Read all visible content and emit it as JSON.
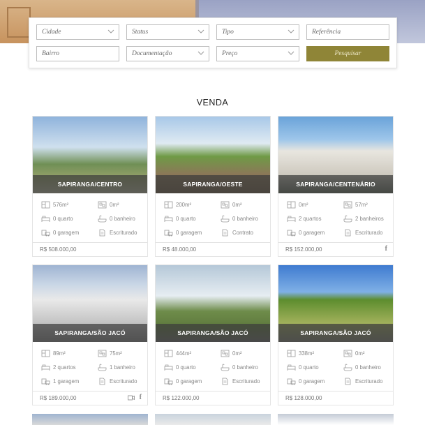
{
  "search": {
    "cidade": "Cidade",
    "status": "Status",
    "tipo": "Tipo",
    "referencia": "Referência",
    "bairro": "Bairro",
    "documentacao": "Documentação",
    "preco": "Preço",
    "button": "Pesquisar"
  },
  "section_title": "VENDA",
  "cards": [
    {
      "location": "SAPIRANGA/CENTRO",
      "area_total": "576m²",
      "area_built": "0m²",
      "quartos": "0 quarto",
      "banheiros": "0 banheiro",
      "garagem": "0 garagem",
      "doc": "Escriturado",
      "price": "R$ 508.000,00",
      "share": {
        "video": false,
        "facebook": false
      }
    },
    {
      "location": "SAPIRANGA/OESTE",
      "area_total": "200m²",
      "area_built": "0m²",
      "quartos": "0 quarto",
      "banheiros": "0 banheiro",
      "garagem": "0 garagem",
      "doc": "Contrato",
      "price": "R$ 48.000,00",
      "share": {
        "video": false,
        "facebook": false
      }
    },
    {
      "location": "SAPIRANGA/CENTENÁRIO",
      "area_total": "0m²",
      "area_built": "57m²",
      "quartos": "2 quartos",
      "banheiros": "2 banheiros",
      "garagem": "0 garagem",
      "doc": "Escriturado",
      "price": "R$ 152.000,00",
      "share": {
        "video": false,
        "facebook": true
      }
    },
    {
      "location": "SAPIRANGA/SÃO JACÓ",
      "area_total": "89m²",
      "area_built": "75m²",
      "quartos": "2 quartos",
      "banheiros": "1 banheiro",
      "garagem": "1 garagem",
      "doc": "Escriturado",
      "price": "R$ 189.000,00",
      "share": {
        "video": true,
        "facebook": true
      }
    },
    {
      "location": "SAPIRANGA/SÃO JACÓ",
      "area_total": "444m²",
      "area_built": "0m²",
      "quartos": "0 quarto",
      "banheiros": "0 banheiro",
      "garagem": "0 garagem",
      "doc": "Escriturado",
      "price": "R$ 122.000,00",
      "share": {
        "video": false,
        "facebook": false
      }
    },
    {
      "location": "SAPIRANGA/SÃO JACÓ",
      "area_total": "338m²",
      "area_built": "0m²",
      "quartos": "0 quarto",
      "banheiros": "0 banheiro",
      "garagem": "0 garagem",
      "doc": "Escriturado",
      "price": "R$ 128.000,00",
      "share": {
        "video": false,
        "facebook": false
      }
    }
  ],
  "icons": [
    "area-total-icon",
    "area-built-icon",
    "bed-icon",
    "bath-icon",
    "garage-icon",
    "document-icon",
    "chevron-down-icon",
    "video-icon",
    "facebook-icon"
  ],
  "colors": {
    "search_button": "#8f8537",
    "location_band": "#3c3c3c"
  }
}
